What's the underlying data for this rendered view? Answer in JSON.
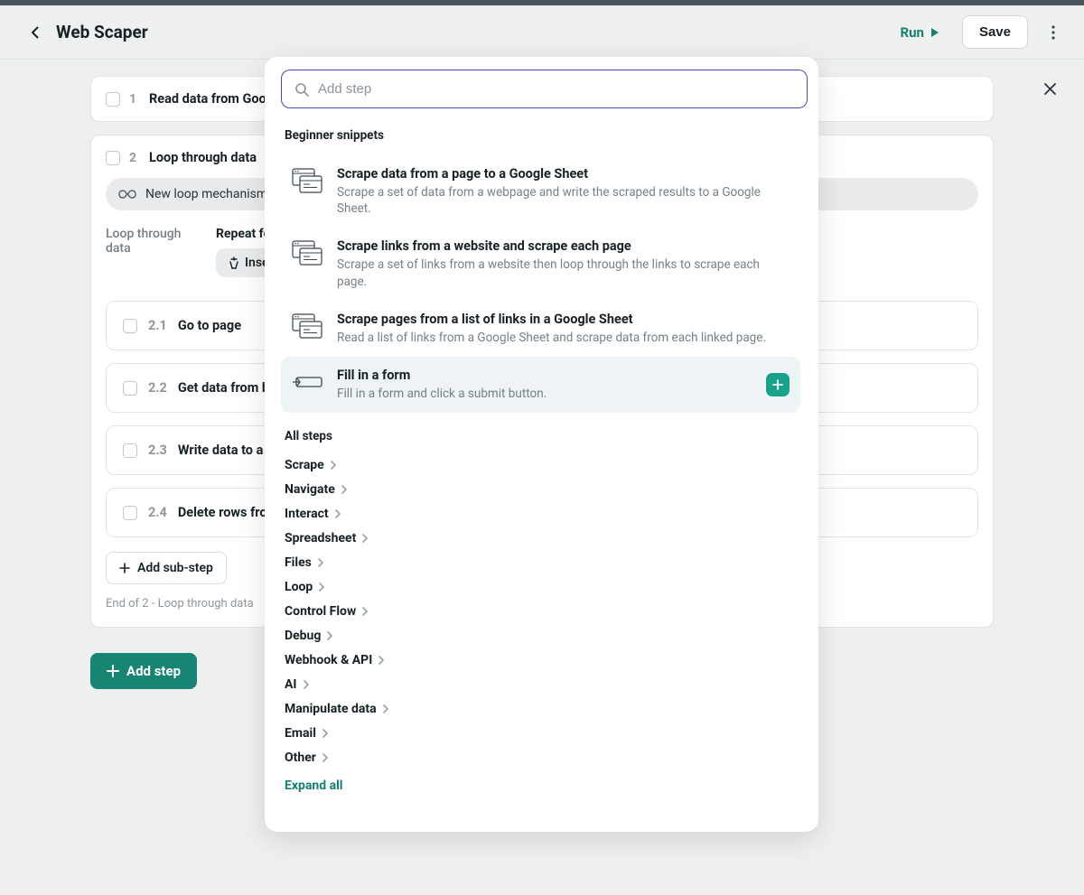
{
  "header": {
    "title": "Web Scaper",
    "run": "Run",
    "save": "Save"
  },
  "steps": {
    "s1_num": "1",
    "s1_text": "Read data from Google Sheets",
    "s2_num": "2",
    "s2_text": "Loop through data",
    "loop_pill": "New loop mechanism, see docs",
    "loop_label": "Loop through data",
    "repeat_label": "Repeat for each item in",
    "insert_label": "Insert variable",
    "sub": [
      {
        "num": "2.1",
        "text": "Go to page"
      },
      {
        "num": "2.2",
        "text": "Get data from book page"
      },
      {
        "num": "2.3",
        "text": "Write data to a Google Sheet"
      },
      {
        "num": "2.4",
        "text": "Delete rows from sheet"
      }
    ],
    "add_sub": "Add sub-step",
    "end_text": "End of 2 - Loop through data",
    "add_step": "Add step"
  },
  "modal": {
    "search_placeholder": "Add step",
    "beginner_head": "Beginner snippets",
    "snippets": [
      {
        "title": "Scrape data from a page to a Google Sheet",
        "desc": "Scrape a set of data from a webpage and write the scraped results to a Google Sheet."
      },
      {
        "title": "Scrape links from a website and scrape each page",
        "desc": "Scrape a set of links from a website then loop through the links to scrape each page."
      },
      {
        "title": "Scrape pages from a list of links in a Google Sheet",
        "desc": "Read a list of links from a Google Sheet and scrape data from each linked page."
      },
      {
        "title": "Fill in a form",
        "desc": "Fill in a form and click a submit button."
      }
    ],
    "all_steps_head": "All steps",
    "categories": [
      "Scrape",
      "Navigate",
      "Interact",
      "Spreadsheet",
      "Files",
      "Loop",
      "Control Flow",
      "Debug",
      "Webhook & API",
      "AI",
      "Manipulate data",
      "Email",
      "Other"
    ],
    "expand_all": "Expand all"
  }
}
